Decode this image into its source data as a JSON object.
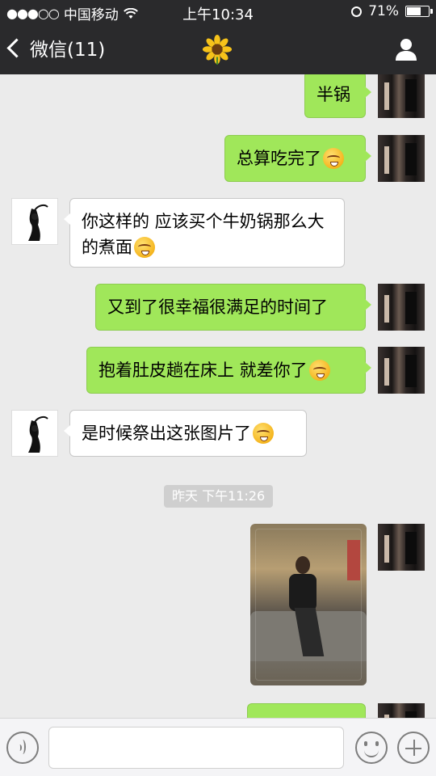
{
  "status_bar": {
    "carrier": "中国移动",
    "signal": "●●●○○",
    "time": "上午10:34",
    "battery": "71%",
    "battery_level": 0.71
  },
  "nav": {
    "back_label": "微信(11)",
    "title_icon": "sunflower-emoji",
    "right_icon": "person-icon"
  },
  "messages": [
    {
      "side": "out",
      "text": "半锅"
    },
    {
      "side": "out",
      "text": "总算吃完了",
      "emoji": "blush-emoji"
    },
    {
      "side": "in",
      "text": "你这样的 应该买个牛奶锅那么大的煮面",
      "emoji": "blush-emoji"
    },
    {
      "side": "out",
      "text": "又到了很幸福很满足的时间了"
    },
    {
      "side": "out",
      "text": "抱着肚皮趟在床上 就差你了",
      "emoji": "blush-emoji"
    },
    {
      "side": "in",
      "text": "是时候祭出这张图片了",
      "emoji": "blush-emoji"
    }
  ],
  "timestamp": "昨天 下午11:26",
  "image_message": {
    "side": "out",
    "content": "photo of woman seated on grey sofa"
  },
  "input_bar": {
    "voice_icon": "voice-icon",
    "emoji_icon": "emoji-icon",
    "plus_icon": "plus-icon",
    "text_value": ""
  },
  "colors": {
    "nav_bg": "#2a2a2c",
    "chat_bg": "#ebebeb",
    "outgoing_bubble": "#a0e75a",
    "incoming_bubble": "#ffffff"
  }
}
